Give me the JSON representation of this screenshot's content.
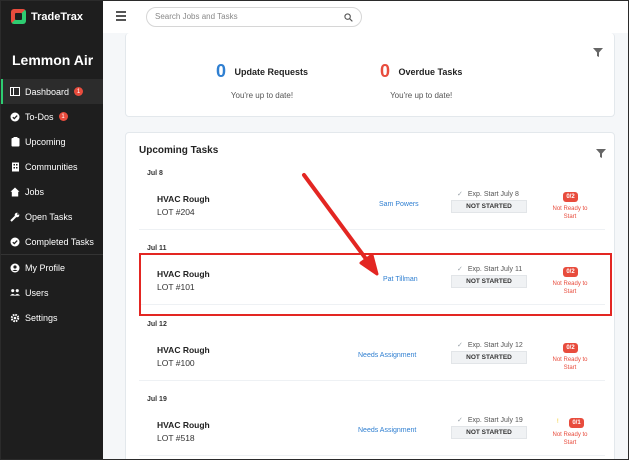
{
  "app": {
    "logo_text": "TradeTrax",
    "company": "Lemmon Air"
  },
  "sidebar": {
    "items": [
      {
        "label": "Dashboard",
        "icon": "dashboard-icon",
        "badge": "1",
        "active": true
      },
      {
        "label": "To-Dos",
        "icon": "check-circle-icon",
        "badge": "1"
      },
      {
        "label": "Upcoming",
        "icon": "clipboard-icon"
      },
      {
        "label": "Communities",
        "icon": "building-icon"
      },
      {
        "label": "Jobs",
        "icon": "home-icon"
      },
      {
        "label": "Open Tasks",
        "icon": "wrench-icon"
      },
      {
        "label": "Completed Tasks",
        "icon": "check-circle-icon"
      },
      {
        "label": "My Profile",
        "icon": "user-circle-icon"
      },
      {
        "label": "Users",
        "icon": "users-icon"
      },
      {
        "label": "Settings",
        "icon": "gear-icon"
      }
    ]
  },
  "header": {
    "search_placeholder": "Search Jobs and Tasks"
  },
  "summary": {
    "update_requests": {
      "count": "0",
      "label": "Update Requests",
      "sub": "You're up to date!",
      "color": "#2f7fd1"
    },
    "overdue_tasks": {
      "count": "0",
      "label": "Overdue Tasks",
      "sub": "You're up to date!",
      "color": "#e84c3d"
    }
  },
  "upcoming": {
    "title": "Upcoming Tasks",
    "groups": [
      {
        "date": "Jul 8",
        "task": "HVAC Rough",
        "lot": "LOT #204",
        "assignee": "Sam Powers",
        "exp": "Exp. Start July 8",
        "status": "NOT STARTED",
        "count": "0/2",
        "ready": "Not Ready to Start"
      },
      {
        "date": "Jul 11",
        "task": "HVAC Rough",
        "lot": "LOT #101",
        "assignee": "Pat Tillman",
        "exp": "Exp. Start July 11",
        "status": "NOT STARTED",
        "count": "0/2",
        "ready": "Not Ready to Start"
      },
      {
        "date": "Jul 12",
        "task": "HVAC Rough",
        "lot": "LOT #100",
        "assignee": "Needs Assignment",
        "exp": "Exp. Start July 12",
        "status": "NOT STARTED",
        "count": "0/2",
        "ready": "Not Ready to Start"
      },
      {
        "date": "Jul 19",
        "task": "HVAC Rough",
        "lot": "LOT #518",
        "assignee": "Needs Assignment",
        "exp": "Exp. Start July 19",
        "status": "NOT STARTED",
        "count": "0/1",
        "ready": "Not Ready to Start",
        "warning": "!"
      }
    ]
  },
  "colors": {
    "accent_green": "#2ecc71",
    "alert_red": "#e84c3d",
    "link_blue": "#2f7fd1",
    "highlight_red": "#e32622"
  }
}
